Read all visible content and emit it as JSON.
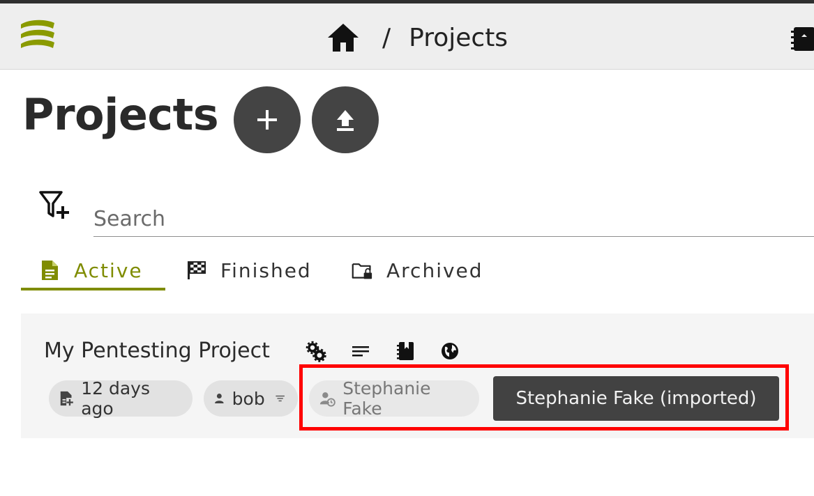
{
  "app": {
    "brand_color": "#7f8c00",
    "appbar_bg": "#eeeeee"
  },
  "breadcrumb": {
    "home_icon": "home-icon",
    "separator": "/",
    "current": "Projects"
  },
  "page": {
    "title": "Projects"
  },
  "actions": {
    "add_icon": "plus-icon",
    "upload_icon": "upload-icon"
  },
  "search": {
    "placeholder": "Search",
    "value": ""
  },
  "tabs": [
    {
      "label": "Active",
      "icon": "file-document-icon",
      "active": true
    },
    {
      "label": "Finished",
      "icon": "checkered-flag-icon",
      "active": false
    },
    {
      "label": "Archived",
      "icon": "folder-lock-icon",
      "active": false
    }
  ],
  "project": {
    "name": "My Pentesting Project",
    "icons": [
      "cogs-icon",
      "notes-icon",
      "notebook-icon",
      "globe-icon"
    ],
    "chips": {
      "date": "12 days ago",
      "user": "bob",
      "imported_user": "Stephanie Fake"
    },
    "tooltip": "Stephanie Fake (imported)"
  },
  "colors": {
    "tooltip_bg": "#424242",
    "highlight": "#ff0000",
    "fab_bg": "#444444"
  }
}
